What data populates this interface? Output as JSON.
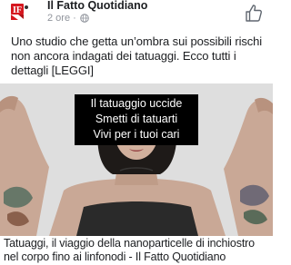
{
  "header": {
    "page_name": "Il Fatto Quotidiano",
    "time": "2 ore",
    "separator": "·",
    "avatar_icon": "il-fatto-quotidiano-logo-icon",
    "privacy_icon": "globe-icon",
    "like_icon": "thumbs-up-icon"
  },
  "post": {
    "caption": "Uno studio che getta un’ombra sui possibili rischi non ancora indagati dei tatuaggi. Ecco tutti i dettagli [LEGGI]"
  },
  "image_overlay": {
    "line1": "Il tatuaggio uccide",
    "line2": "Smetti di tatuarti",
    "line3": "Vivi per i tuoi cari"
  },
  "link": {
    "title": "Tatuaggi, il viaggio della nanoparticelle di inchiostro nel corpo fino ai linfonodi - Il Fatto Quotidiano"
  },
  "colors": {
    "logo_red": "#d6171f",
    "text": "#1c1e21",
    "meta": "#90949c",
    "overlay_bg": "#000000"
  }
}
